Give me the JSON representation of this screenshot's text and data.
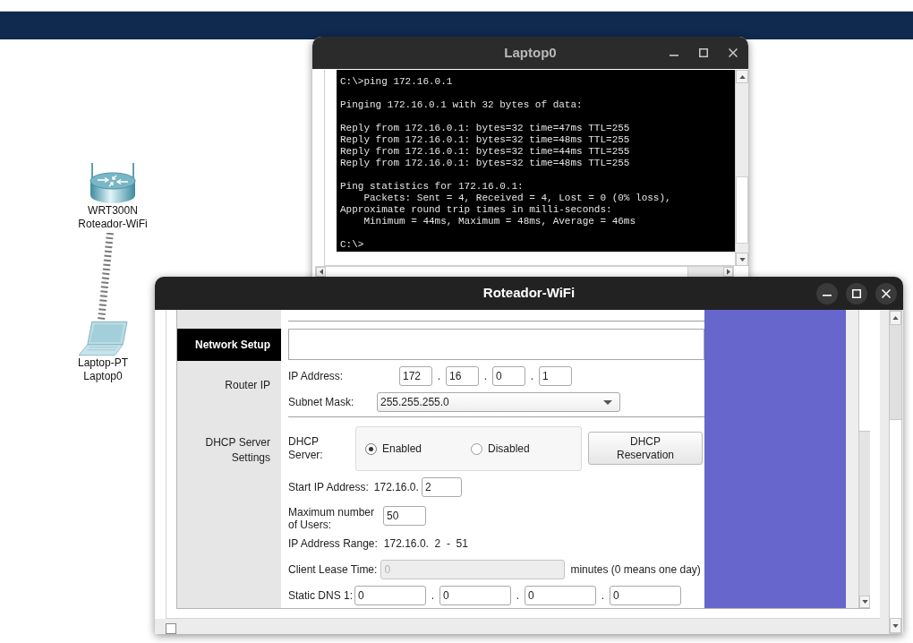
{
  "canvas": {
    "devices": [
      {
        "kind": "router",
        "model": "WRT300N",
        "name": "Roteador-WiFi"
      },
      {
        "kind": "laptop",
        "model": "Laptop-PT",
        "name": "Laptop0"
      }
    ],
    "links": [
      {
        "kind": "wireless"
      }
    ]
  },
  "terminal_window": {
    "title": "Laptop0",
    "blocks": [
      [
        "C:\\>ping 172.16.0.1"
      ],
      [
        "Pinging 172.16.0.1 with 32 bytes of data:"
      ],
      [
        "Reply from 172.16.0.1: bytes=32 time=47ms TTL=255",
        "Reply from 172.16.0.1: bytes=32 time=48ms TTL=255",
        "Reply from 172.16.0.1: bytes=32 time=44ms TTL=255",
        "Reply from 172.16.0.1: bytes=32 time=48ms TTL=255"
      ],
      [
        "Ping statistics for 172.16.0.1:",
        "    Packets: Sent = 4, Received = 4, Lost = 0 (0% loss),",
        "Approximate round trip times in milli-seconds:",
        "    Minimum = 44ms, Maximum = 48ms, Average = 46ms"
      ],
      [
        "C:\\>"
      ]
    ]
  },
  "router_window": {
    "title": "Roteador-WiFi",
    "sections": [
      {
        "kind": "header",
        "label": "Network Setup"
      },
      {
        "kind": "router_ip",
        "label": "Router IP",
        "ip_address": {
          "label": "IP Address:",
          "octets": [
            "172",
            "16",
            "0",
            "1"
          ],
          "separators": [
            ".",
            ".",
            "."
          ]
        },
        "subnet_mask": {
          "label": "Subnet Mask:",
          "value": "255.255.255.0"
        }
      },
      {
        "kind": "dhcp",
        "label": "DHCP Server Settings",
        "dhcp_server": {
          "label": "DHCP Server:",
          "options": [
            {
              "label": "Enabled",
              "selected": true
            },
            {
              "label": "Disabled",
              "selected": false
            }
          ]
        },
        "reservation_button": "DHCP Reservation",
        "start_ip": {
          "label": "Start IP Address:",
          "prefix": "172.16.0.",
          "value": "2"
        },
        "max_users": {
          "label": "Maximum number of Users:",
          "value": "50"
        },
        "ip_range": {
          "label": "IP Address Range:",
          "value": "172.16.0.  2  -  51"
        },
        "lease_time": {
          "label": "Client Lease Time:",
          "value": "0",
          "disabled": true,
          "unit": "minutes (0 means one day)"
        },
        "static_dns_1": {
          "label": "Static DNS 1:",
          "octets": [
            "0",
            "0",
            "0",
            "0"
          ],
          "separators": [
            ".",
            ".",
            "."
          ]
        }
      }
    ],
    "bottom_checkbox": {
      "checked": false
    }
  }
}
